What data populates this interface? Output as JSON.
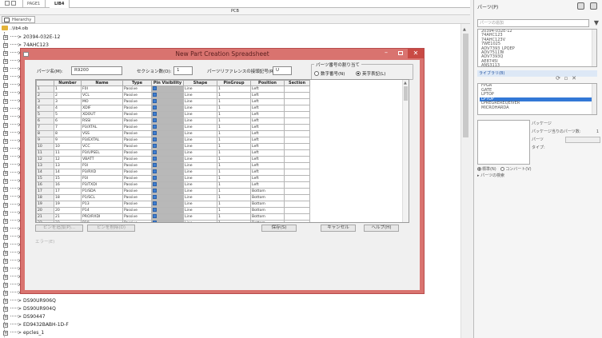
{
  "tabs": [
    {
      "label": "PAGE1"
    },
    {
      "label": "LIB4"
    }
  ],
  "pcb_title": "PCB",
  "tree": {
    "toolbar_label": "Hierarchy",
    "root": "..\\lib4.olb",
    "items": [
      "20394-032E-12",
      "74AHC123",
      "",
      "",
      "",
      "",
      "",
      "",
      "",
      "",
      "",
      "",
      "",
      "",
      "",
      "",
      "",
      "",
      "",
      "",
      "",
      "",
      "",
      "",
      "",
      "",
      "",
      "",
      "",
      "",
      "",
      "",
      "",
      "DS90UR906Q",
      "DS90UR904Q",
      "DS90447",
      "ED9432BABH-1D-F",
      "epcles_1"
    ]
  },
  "right_panel": {
    "title": "パーツ(P)",
    "search_placeholder": "パーツの追加",
    "parts": [
      "20394-032E-12",
      "74AHC123",
      "74AHC123V",
      "7WE1025",
      "ADV7393_LPQEP",
      "ADV7511W",
      "ADV7393Q",
      "AE8745I",
      "ANS3113"
    ],
    "libraries_title": "ライブラリ(B)",
    "libraries": [
      "FPGA",
      "GATE",
      "LPTOP",
      "LPTOP",
      "LPREGREREQEIVER",
      "MICROHARDA"
    ],
    "selected_library": 3,
    "package_label": "パッケージ",
    "package_parts_label": "パッケージ当りのパーツ数:",
    "package_parts_value": "1",
    "part_label": "パーツ",
    "type_label": "タイプ:",
    "radio_normal": "標準(N)",
    "radio_convert": "コンバート(V)",
    "search_parts": "パーツの検索"
  },
  "dialog": {
    "title": "New Part Creation Spreadsheet",
    "part_name_label": "パーツ名(M):",
    "part_name_value": "R9200",
    "section_count_label": "セクション数(O):",
    "section_count_value": "1",
    "part_ref_label": "パーツリファレンスの接頭記号(R):",
    "part_ref_value": "U",
    "numbering_group_title": "パーツ番号の割り当て",
    "radio_numeric": "数字番号(N)",
    "radio_alpha": "英字表記(L)",
    "columns": [
      "",
      "Number",
      "Name",
      "Type",
      "Pin Visibility",
      "Shape",
      "PinGroup",
      "Position",
      "Section"
    ],
    "rows": [
      [
        "1",
        "1",
        "F0I",
        "Passive",
        "Line",
        "1",
        "Left"
      ],
      [
        "2",
        "2",
        "VCL",
        "Passive",
        "Line",
        "1",
        "Left"
      ],
      [
        "3",
        "3",
        "MO",
        "Passive",
        "Line",
        "1",
        "Left"
      ],
      [
        "4",
        "4",
        "XDIF",
        "Passive",
        "Line",
        "1",
        "Left"
      ],
      [
        "5",
        "5",
        "XDOUT",
        "Passive",
        "Line",
        "1",
        "Left"
      ],
      [
        "6",
        "6",
        "RSSI",
        "Passive",
        "Line",
        "1",
        "Left"
      ],
      [
        "7",
        "7",
        "P3/XTAL",
        "Passive",
        "Line",
        "1",
        "Left"
      ],
      [
        "8",
        "8",
        "VSS",
        "Passive",
        "Line",
        "1",
        "Left"
      ],
      [
        "9",
        "9",
        "P3/EXTAL",
        "Passive",
        "Line",
        "1",
        "Left"
      ],
      [
        "10",
        "10",
        "VCC",
        "Passive",
        "Line",
        "1",
        "Left"
      ],
      [
        "11",
        "11",
        "P3/UPSEL",
        "Passive",
        "Line",
        "1",
        "Left"
      ],
      [
        "12",
        "12",
        "VBATT",
        "Passive",
        "Line",
        "1",
        "Left"
      ],
      [
        "13",
        "13",
        "P3I",
        "Passive",
        "Line",
        "1",
        "Left"
      ],
      [
        "14",
        "14",
        "P3/RXD",
        "Passive",
        "Line",
        "1",
        "Left"
      ],
      [
        "15",
        "15",
        "P3I",
        "Passive",
        "Line",
        "1",
        "Left"
      ],
      [
        "16",
        "16",
        "P3/TXDI",
        "Passive",
        "Line",
        "1",
        "Left"
      ],
      [
        "17",
        "17",
        "P1/SDA",
        "Passive",
        "Line",
        "1",
        "Bottom"
      ],
      [
        "18",
        "18",
        "P1/SCL",
        "Passive",
        "Line",
        "1",
        "Bottom"
      ],
      [
        "19",
        "19",
        "P13",
        "Passive",
        "Line",
        "1",
        "Bottom"
      ],
      [
        "20",
        "20",
        "P14",
        "Passive",
        "Line",
        "1",
        "Bottom"
      ],
      [
        "21",
        "21",
        "PRO/RXDI",
        "Passive",
        "Line",
        "1",
        "Bottom"
      ],
      [
        "22",
        "22",
        "P10",
        "Passive",
        "Line",
        "1",
        "Bottom"
      ],
      [
        "23",
        "23",
        "PHI",
        "Passive",
        "Line",
        "1",
        "Bottom"
      ],
      [
        "24",
        "24",
        "PRO/SHEEB",
        "Passive",
        "Line",
        "1",
        "Bottom"
      ],
      [
        "25",
        "25",
        "P0I",
        "Passive",
        "Line",
        "1",
        "Bottom"
      ]
    ],
    "btn_add_pin": "ピンを追加(P)...",
    "btn_delete_pin": "ピンを削除(D)",
    "btn_save": "保存(S)",
    "btn_cancel": "キャンセル",
    "btn_help": "ヘルプ(H)",
    "footnote": "エラー(E)"
  }
}
